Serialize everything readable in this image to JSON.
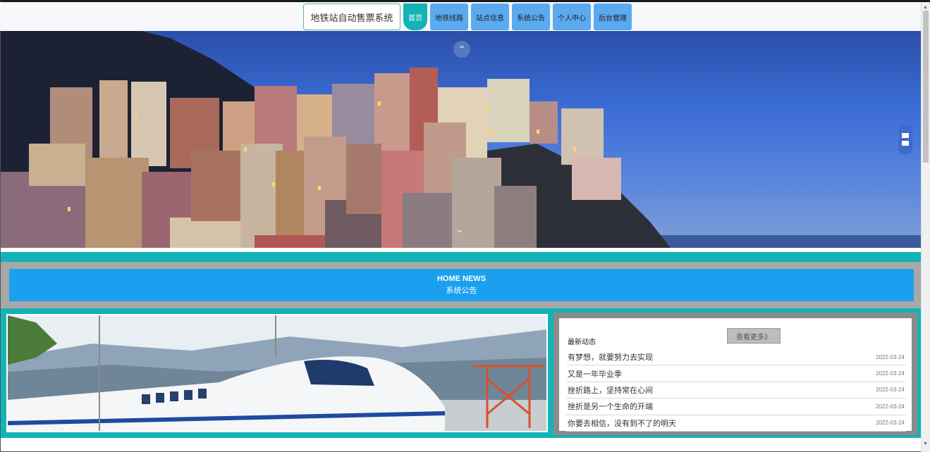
{
  "header": {
    "brand": "地铁站自动售票系统",
    "nav": [
      {
        "label": "首页",
        "active": true
      },
      {
        "label": "地铁线路",
        "active": false
      },
      {
        "label": "站点信息",
        "active": false
      },
      {
        "label": "系统公告",
        "active": false
      },
      {
        "label": "个人中心",
        "active": false
      },
      {
        "label": "后台管理",
        "active": false
      }
    ]
  },
  "hero": {
    "up_icon": "chevron-up-icon",
    "down_icon": "chevron-down-icon"
  },
  "news_section": {
    "title_en": "HOME NEWS",
    "title_cn": "系统公告"
  },
  "latest": {
    "title": "最新动态",
    "more_label": "查看更多》",
    "items": [
      {
        "title": "有梦想，就要努力去实现",
        "date": "2022-03-24"
      },
      {
        "title": "又是一年毕业季",
        "date": "2022-03-24"
      },
      {
        "title": "挫折路上，坚持常在心间",
        "date": "2022-03-24"
      },
      {
        "title": "挫折是另一个生命的开端",
        "date": "2022-03-24"
      },
      {
        "title": "你要去相信，没有到不了的明天",
        "date": "2022-03-24"
      }
    ]
  },
  "colors": {
    "accent_teal": "#13b3b6",
    "nav_blue": "#5aaaf0",
    "band_blue": "#1aa0ee"
  }
}
